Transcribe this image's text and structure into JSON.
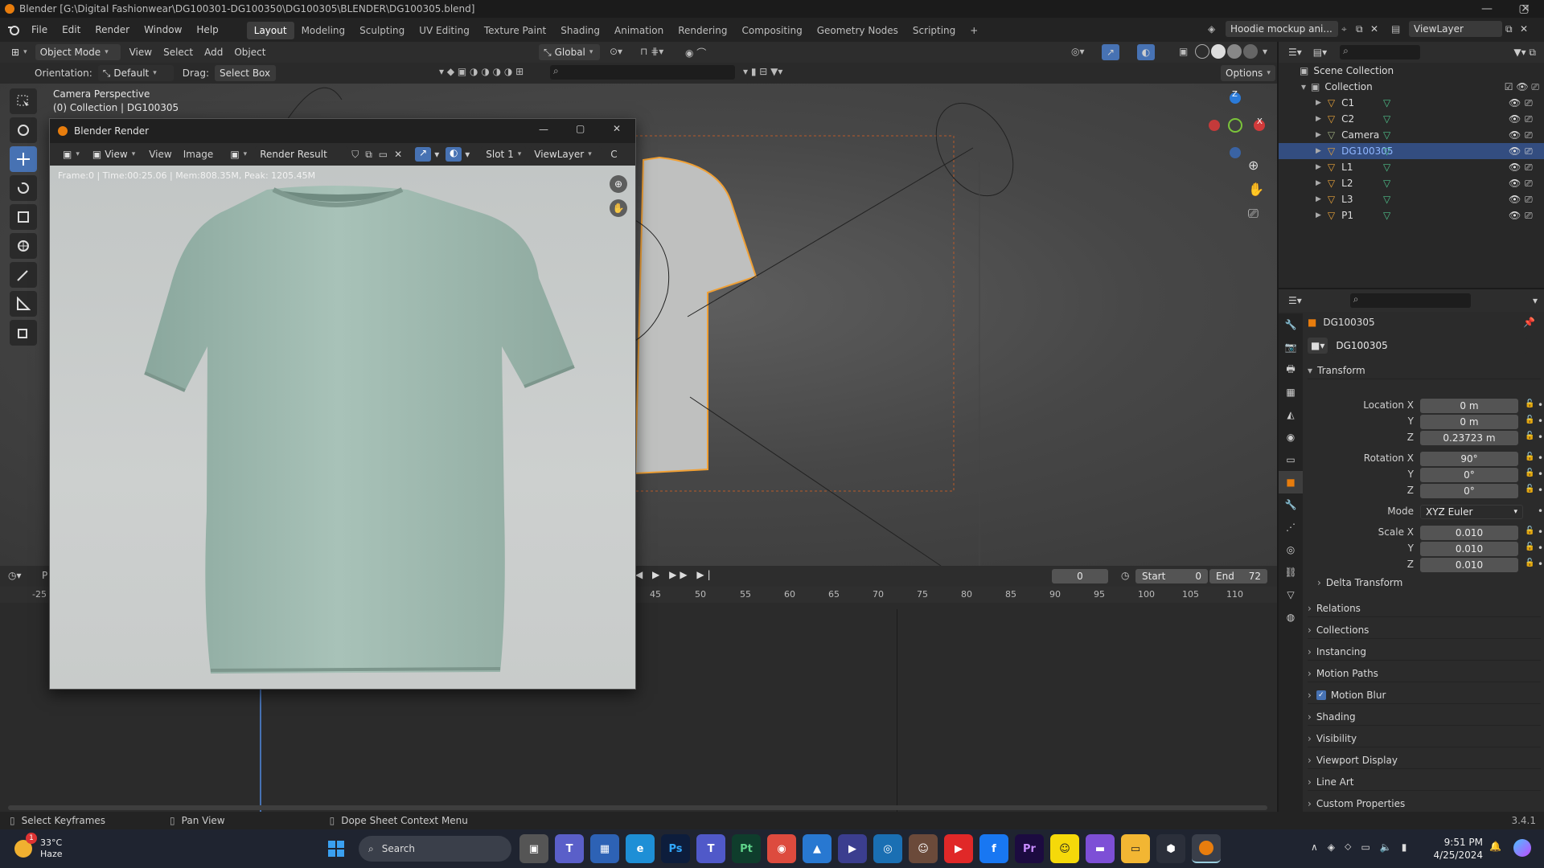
{
  "window": {
    "title": "Blender [G:\\Digital Fashionwear\\DG100301-DG100350\\DG100305\\BLENDER\\DG100305.blend]"
  },
  "menus": [
    "File",
    "Edit",
    "Render",
    "Window",
    "Help"
  ],
  "workspaces": [
    "Layout",
    "Modeling",
    "Sculpting",
    "UV Editing",
    "Texture Paint",
    "Shading",
    "Animation",
    "Rendering",
    "Compositing",
    "Geometry Nodes",
    "Scripting"
  ],
  "active_workspace": "Layout",
  "scene_name": "Hoodie mockup ani...",
  "view_layer": "ViewLayer",
  "viewport_header": {
    "mode": "Object Mode",
    "view": "View",
    "select": "Select",
    "add": "Add",
    "object": "Object",
    "transform": "Global",
    "options": "Options"
  },
  "tool_settings": {
    "orientation_label": "Orientation:",
    "orientation_value": "Default",
    "drag_label": "Drag:",
    "drag_value": "Select Box"
  },
  "viewport_overlay": {
    "line1": "Camera Perspective",
    "line2": "(0) Collection | DG100305"
  },
  "gizmo": {
    "z": "Z",
    "x": "X"
  },
  "render_window": {
    "title": "Blender Render",
    "menu_view": "View",
    "menu_view2": "View",
    "menu_image": "Image",
    "image_name": "Render Result",
    "slot": "Slot 1",
    "layer": "ViewLayer",
    "extra": "C",
    "stats": "Frame:0 | Time:00:25.06 | Mem:808.35M, Peak: 1205.45M"
  },
  "outliner": {
    "root": "Scene Collection",
    "collection": "Collection",
    "items": [
      {
        "name": "C1",
        "selected": false
      },
      {
        "name": "C2",
        "selected": false
      },
      {
        "name": "Camera",
        "selected": false
      },
      {
        "name": "DG100305",
        "selected": true
      },
      {
        "name": "L1",
        "selected": false
      },
      {
        "name": "L2",
        "selected": false
      },
      {
        "name": "L3",
        "selected": false
      },
      {
        "name": "P1",
        "selected": false
      }
    ]
  },
  "properties": {
    "object_name": "DG100305",
    "data_name": "DG100305",
    "transform_label": "Transform",
    "location_label": "Location X",
    "location": [
      "0 m",
      "0 m",
      "0.23723 m"
    ],
    "rotation_label": "Rotation X",
    "rotation": [
      "90°",
      "0°",
      "0°"
    ],
    "mode_label": "Mode",
    "mode_value": "XYZ Euler",
    "scale_label": "Scale X",
    "scale": [
      "0.010",
      "0.010",
      "0.010"
    ],
    "axis_y": "Y",
    "axis_z": "Z",
    "delta_transform": "Delta Transform",
    "panels": [
      "Relations",
      "Collections",
      "Instancing",
      "Motion Paths",
      "Motion Blur",
      "Shading",
      "Visibility",
      "Viewport Display",
      "Line Art",
      "Custom Properties"
    ]
  },
  "timeline": {
    "current_frame": "0",
    "start_label": "Start",
    "start": "0",
    "end_label": "End",
    "end": "72",
    "ruler": [
      "-25",
      "45",
      "50",
      "55",
      "60",
      "65",
      "70",
      "75",
      "80",
      "85",
      "90",
      "95",
      "100",
      "105",
      "110"
    ],
    "p_label": "P"
  },
  "statusbar": {
    "left": "Select Keyframes",
    "mid": "Pan View",
    "right": "Dope Sheet Context Menu",
    "version": "3.4.1"
  },
  "taskbar": {
    "weather_temp": "33°C",
    "weather_desc": "Haze",
    "search": "Search",
    "time": "9:51 PM",
    "date": "4/25/2024",
    "badge": "1"
  }
}
